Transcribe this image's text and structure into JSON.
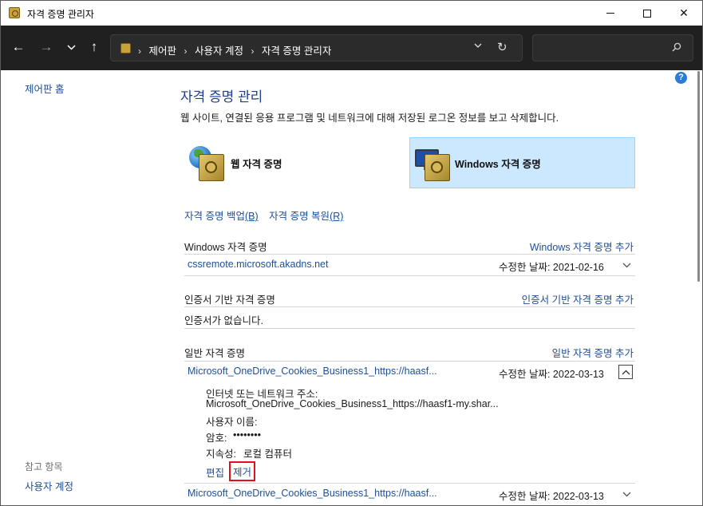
{
  "window": {
    "title": "자격 증명 관리자",
    "close_glyph": "✕"
  },
  "nav": {
    "back": "←",
    "forward": "→",
    "recent": "⌄",
    "up": "↑",
    "breadcrumbs": [
      "제어판",
      "사용자 계정",
      "자격 증명 관리자"
    ],
    "separator": "›",
    "dropdown": "⌄",
    "refresh": "↻"
  },
  "search": {
    "placeholder": ""
  },
  "left": {
    "home": "제어판 홈",
    "see_also": "참고 항목",
    "user_accounts": "사용자 계정"
  },
  "help": "?",
  "main": {
    "title": "자격 증명 관리",
    "description": "웹 사이트, 연결된 응용 프로그램 및 네트워크에 대해 저장된 로그온 정보를 보고 삭제합니다.",
    "tiles": {
      "web": "웹 자격 증명",
      "windows": "Windows 자격 증명"
    },
    "backup_text": "자격 증명 백업",
    "backup_key": "(B)",
    "restore_text": "자격 증명 복원",
    "restore_key": "(R)"
  },
  "sections": {
    "windows": {
      "header": "Windows 자격 증명",
      "add": "Windows 자격 증명 추가",
      "entries": [
        {
          "name": "cssremote.microsoft.akadns.net",
          "date": "수정한 날짜:  2021-02-16"
        }
      ]
    },
    "certificate": {
      "header": "인증서 기반 자격 증명",
      "add": "인증서 기반 자격 증명 추가",
      "empty": "인증서가 없습니다."
    },
    "generic": {
      "header": "일반 자격 증명",
      "add": "일반 자격 증명 추가",
      "entries": [
        {
          "name": "Microsoft_OneDrive_Cookies_Business1_https://haasf...",
          "date": "수정한 날짜:  2022-03-13",
          "expanded": true,
          "address_label": "인터넷 또는 네트워크 주소:",
          "address_value": "Microsoft_OneDrive_Cookies_Business1_https://haasf1-my.shar...",
          "username_label": "사용자 이름:",
          "password_label": "암호:",
          "password_value": "••••••••",
          "persistence_label": "지속성:",
          "persistence_value": "로컬 컴퓨터",
          "edit": "편집",
          "remove": "제거"
        },
        {
          "name": "Microsoft_OneDrive_Cookies_Business1_https://haasf...",
          "date": "수정한 날짜:  2022-03-13",
          "expanded": false
        }
      ]
    }
  }
}
